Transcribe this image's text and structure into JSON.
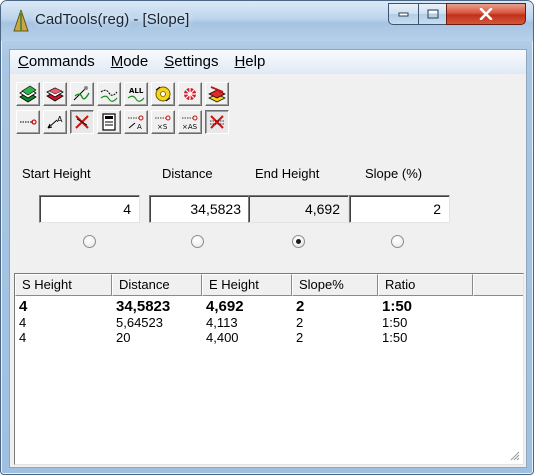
{
  "window": {
    "title": "CadTools(reg) - [Slope]",
    "controls": {
      "minimize": "minimize",
      "maximize": "maximize",
      "close": "close"
    }
  },
  "menu": {
    "items": [
      "Commands",
      "Mode",
      "Settings",
      "Help"
    ]
  },
  "toolbar": {
    "row1": [
      "layer-green-icon",
      "layer-red-icon",
      "slope-curve-icon",
      "curve-point-icon",
      "all-curves-icon",
      "gear-yellow-icon",
      "snowflake-red-icon",
      "layer-flag-icon"
    ],
    "row2": [
      "dimension-line-icon",
      "arrow-angle-icon",
      "delete-x-icon",
      "calculator-icon",
      "point-distance-a-icon",
      "point-distance-s-icon",
      "point-distance-as-icon",
      "crossed-delete-icon"
    ],
    "row2_pressed": [
      2
    ]
  },
  "fields": {
    "start_height": {
      "label": "Start Height",
      "value": "4"
    },
    "distance": {
      "label": "Distance",
      "value": "34,5823"
    },
    "end_height": {
      "label": "End Height",
      "value": "4,692"
    },
    "slope": {
      "label": "Slope (%)",
      "value": "2"
    }
  },
  "radios": {
    "selected": "end_height"
  },
  "table": {
    "columns": [
      "S Height",
      "Distance",
      "E Height",
      "Slope%",
      "Ratio"
    ],
    "rows": [
      [
        "4",
        "34,5823",
        "4,692",
        "2",
        "1:50"
      ],
      [
        "4",
        "5,64523",
        "4,113",
        "2",
        "1:50"
      ],
      [
        "4",
        "20",
        "4,400",
        "2",
        "1:50"
      ]
    ],
    "bold_row": 0
  },
  "colors": {
    "title_bar": "#bcd4ec",
    "close_button": "#c0301b",
    "client_bg": "#f0f0f0"
  }
}
